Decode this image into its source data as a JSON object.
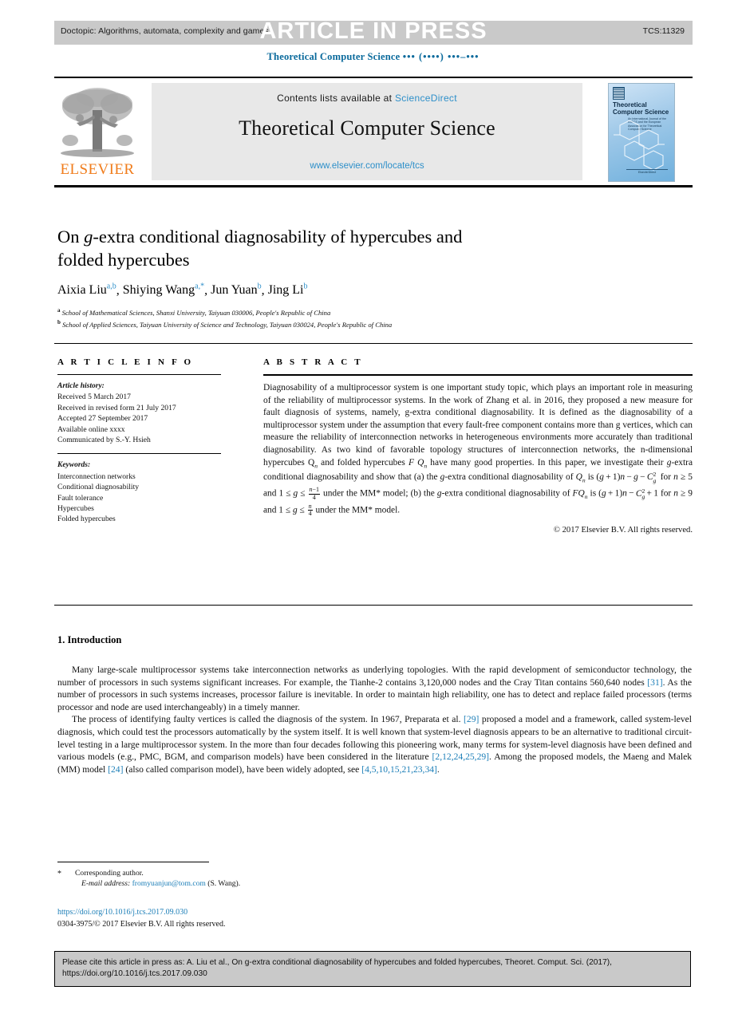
{
  "header": {
    "doctopic": "Doctopic: Algorithms, automata, complexity and games",
    "article_in_press": "ARTICLE IN PRESS",
    "manuscript_id": "TCS:11329",
    "running_head_journal": "Theoretical Computer Science",
    "running_head_pages": "••• (••••) •••–•••"
  },
  "masthead": {
    "contents_label": "Contents lists available at",
    "sciencedirect": "ScienceDirect",
    "journal_title": "Theoretical Computer Science",
    "journal_url": "www.elsevier.com/locate/tcs",
    "publisher": "ELSEVIER",
    "cover_title": "Theoretical Computer Science",
    "cover_subtitle": "An International Journal of the EATCS and the European Association for Theoretical Computer Science",
    "cover_footer": "ElsevierDirect"
  },
  "article": {
    "title": "On g-extra conditional diagnosability of hypercubes and folded hypercubes",
    "authors": [
      {
        "name": "Aixia Liu",
        "marks": "a,b"
      },
      {
        "name": "Shiying Wang",
        "marks": "a,*"
      },
      {
        "name": "Jun Yuan",
        "marks": "b"
      },
      {
        "name": "Jing Li",
        "marks": "b"
      }
    ],
    "affiliations": [
      {
        "mark": "a",
        "text": "School of Mathematical Sciences, Shanxi University, Taiyuan 030006, People's Republic of China"
      },
      {
        "mark": "b",
        "text": "School of Applied Sciences, Taiyuan University of Science and Technology, Taiyuan 030024, People's Republic of China"
      }
    ]
  },
  "article_info": {
    "heading": "A R T I C L E   I N F O",
    "history_label": "Article history:",
    "history": [
      "Received 5 March 2017",
      "Received in revised form 21 July 2017",
      "Accepted 27 September 2017",
      "Available online xxxx",
      "Communicated by S.-Y. Hsieh"
    ],
    "keywords_label": "Keywords:",
    "keywords": [
      "Interconnection networks",
      "Conditional diagnosability",
      "Fault tolerance",
      "Hypercubes",
      "Folded hypercubes"
    ]
  },
  "abstract": {
    "heading": "A B S T R A C T",
    "p1": "Diagnosability of a multiprocessor system is one important study topic, which plays an important role in measuring of the reliability of multiprocessor systems. In the work of Zhang et al. in 2016, they proposed a new measure for fault diagnosis of systems, namely, g-extra conditional diagnosability. It is defined as the diagnosability of a multiprocessor system under the assumption that every fault-free component contains more than g vertices, which can measure the reliability of interconnection networks in heterogeneous environments more accurately than traditional diagnosability. As two kind of favorable topology structures of interconnection networks, the n-dimensional hypercubes Q",
    "copyright": "© 2017 Elsevier B.V. All rights reserved."
  },
  "intro": {
    "heading": "1. Introduction",
    "p1": "Many large-scale multiprocessor systems take interconnection networks as underlying topologies. With the rapid development of semiconductor technology, the number of processors in such systems significant increases. For example, the Tianhe-2 contains 3,120,000 nodes and the Cray Titan contains 560,640 nodes",
    "p1_cite": "[31]",
    "p1_rest": ". As the number of processors in such systems increases, processor failure is inevitable. In order to maintain high reliability, one has to detect and replace failed processors (terms processor and node are used interchangeably) in a timely manner.",
    "p2_a": "The process of identifying faulty vertices is called the diagnosis of the system. In 1967, Preparata et al.",
    "p2_cite1": "[29]",
    "p2_b": "proposed a model and a framework, called system-level diagnosis, which could test the processors automatically by the system itself. It is well known that system-level diagnosis appears to be an alternative to traditional circuit-level testing in a large multiprocessor system. In the more than four decades following this pioneering work, many terms for system-level diagnosis have been defined and various models (e.g., PMC, BGM, and comparison models) have been considered in the literature",
    "p2_cite2": "[2,12,24,25,29]",
    "p2_c": ". Among the proposed models, the Maeng and Malek (MM) model",
    "p2_cite3": "[24]",
    "p2_d": "(also called comparison model), have been widely adopted, see",
    "p2_cite4": "[4,5,10,15,21,23,34]",
    "p2_e": "."
  },
  "footnotes": {
    "corresponding": "Corresponding author.",
    "email_label": "E-mail address:",
    "email": "fromyuanjun@tom.com",
    "email_owner": "(S. Wang).",
    "doi": "https://doi.org/10.1016/j.tcs.2017.09.030",
    "issn_line": "0304-3975/© 2017 Elsevier B.V. All rights reserved."
  },
  "cite_box": {
    "line1": "Please cite this article in press as: A. Liu et al., On g-extra conditional diagnosability of hypercubes and folded hypercubes, Theoret. Comput. Sci. (2017),",
    "line2": "https://doi.org/10.1016/j.tcs.2017.09.030"
  },
  "colors": {
    "link": "#2d8fc9",
    "citation": "#1d7fb8",
    "journal_blue": "#0a6a9c",
    "elsevier_orange": "#f07c1b",
    "bar_grey": "#c9c9c9"
  }
}
